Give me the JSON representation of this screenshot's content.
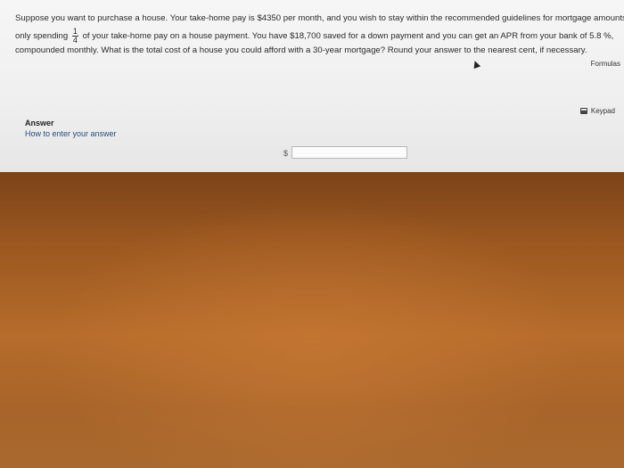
{
  "question": {
    "line1": "Suppose you want to purchase a house. Your take-home pay is $4350 per month, and you wish to stay within the recommended guidelines for mortgage amounts by",
    "line2_prefix": "only spending",
    "fraction_numerator": "1",
    "fraction_denominator": "4",
    "line2_suffix": "of your take-home pay on a house payment. You have $18,700 saved for a down payment and you can get an APR from your bank of 5.8 %,",
    "line3": "compounded monthly. What is the total cost of a house you could afford with a 30-year mortgage? Round your answer to the nearest cent, if necessary."
  },
  "toolbar": {
    "formulas_label": "Formulas",
    "keypad_label": "Keypad",
    "keypad_icon": "keypad-icon"
  },
  "answer": {
    "label": "Answer",
    "help_link": "How to enter your answer",
    "currency_symbol": "$",
    "value": ""
  }
}
